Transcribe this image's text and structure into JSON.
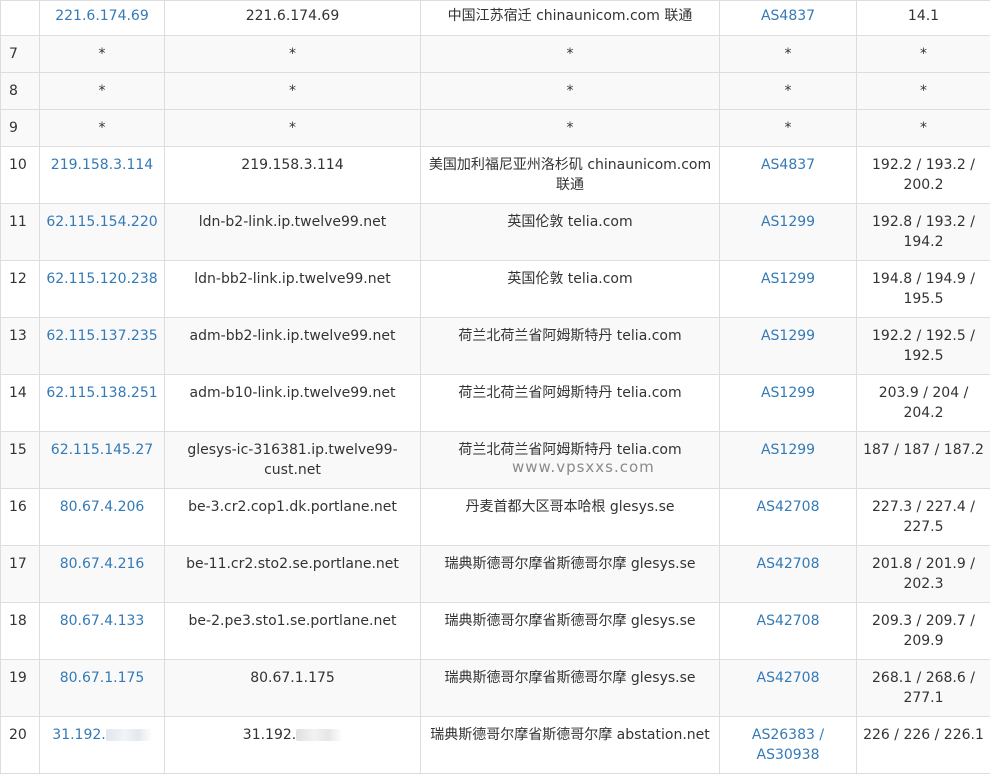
{
  "watermark": "www.vpsxxs.com",
  "rows": [
    {
      "hop": "",
      "ip": "221.6.174.69",
      "host": "221.6.174.69",
      "loc": "中国江苏宿迁 chinaunicom.com 联通",
      "asn": "AS4837",
      "asn2": "",
      "time": "14.1"
    },
    {
      "hop": "7",
      "ip": "*",
      "host": "*",
      "loc": "*",
      "asn": "*",
      "asn2": "",
      "time": "*"
    },
    {
      "hop": "8",
      "ip": "*",
      "host": "*",
      "loc": "*",
      "asn": "*",
      "asn2": "",
      "time": "*"
    },
    {
      "hop": "9",
      "ip": "*",
      "host": "*",
      "loc": "*",
      "asn": "*",
      "asn2": "",
      "time": "*"
    },
    {
      "hop": "10",
      "ip": "219.158.3.114",
      "host": "219.158.3.114",
      "loc": "美国加利福尼亚州洛杉矶 chinaunicom.com 联通",
      "asn": "AS4837",
      "asn2": "",
      "time": "192.2 / 193.2 / 200.2"
    },
    {
      "hop": "11",
      "ip": "62.115.154.220",
      "host": "ldn-b2-link.ip.twelve99.net",
      "loc": "英国伦敦 telia.com",
      "asn": "AS1299",
      "asn2": "",
      "time": "192.8 / 193.2 / 194.2"
    },
    {
      "hop": "12",
      "ip": "62.115.120.238",
      "host": "ldn-bb2-link.ip.twelve99.net",
      "loc": "英国伦敦 telia.com",
      "asn": "AS1299",
      "asn2": "",
      "time": "194.8 / 194.9 / 195.5"
    },
    {
      "hop": "13",
      "ip": "62.115.137.235",
      "host": "adm-bb2-link.ip.twelve99.net",
      "loc": "荷兰北荷兰省阿姆斯特丹 telia.com",
      "asn": "AS1299",
      "asn2": "",
      "time": "192.2 / 192.5 / 192.5"
    },
    {
      "hop": "14",
      "ip": "62.115.138.251",
      "host": "adm-b10-link.ip.twelve99.net",
      "loc": "荷兰北荷兰省阿姆斯特丹 telia.com",
      "asn": "AS1299",
      "asn2": "",
      "time": "203.9 / 204 / 204.2"
    },
    {
      "hop": "15",
      "ip": "62.115.145.27",
      "host": "glesys-ic-316381.ip.twelve99-cust.net",
      "loc": "荷兰北荷兰省阿姆斯特丹 telia.com",
      "asn": "AS1299",
      "asn2": "",
      "time": "187 / 187 / 187.2"
    },
    {
      "hop": "16",
      "ip": "80.67.4.206",
      "host": "be-3.cr2.cop1.dk.portlane.net",
      "loc": "丹麦首都大区哥本哈根 glesys.se",
      "asn": "AS42708",
      "asn2": "",
      "time": "227.3 / 227.4 / 227.5"
    },
    {
      "hop": "17",
      "ip": "80.67.4.216",
      "host": "be-11.cr2.sto2.se.portlane.net",
      "loc": "瑞典斯德哥尔摩省斯德哥尔摩 glesys.se",
      "asn": "AS42708",
      "asn2": "",
      "time": "201.8 / 201.9 / 202.3"
    },
    {
      "hop": "18",
      "ip": "80.67.4.133",
      "host": "be-2.pe3.sto1.se.portlane.net",
      "loc": "瑞典斯德哥尔摩省斯德哥尔摩 glesys.se",
      "asn": "AS42708",
      "asn2": "",
      "time": "209.3 / 209.7 / 209.9"
    },
    {
      "hop": "19",
      "ip": "80.67.1.175",
      "host": "80.67.1.175",
      "loc": "瑞典斯德哥尔摩省斯德哥尔摩 glesys.se",
      "asn": "AS42708",
      "asn2": "",
      "time": "268.1 / 268.6 / 277.1"
    },
    {
      "hop": "20",
      "ip": "31.192.",
      "host": "31.192.",
      "loc": "瑞典斯德哥尔摩省斯德哥尔摩 abstation.net",
      "asn": "AS26383 /",
      "asn2": "AS30938",
      "time": "226 / 226 / 226.1"
    }
  ]
}
